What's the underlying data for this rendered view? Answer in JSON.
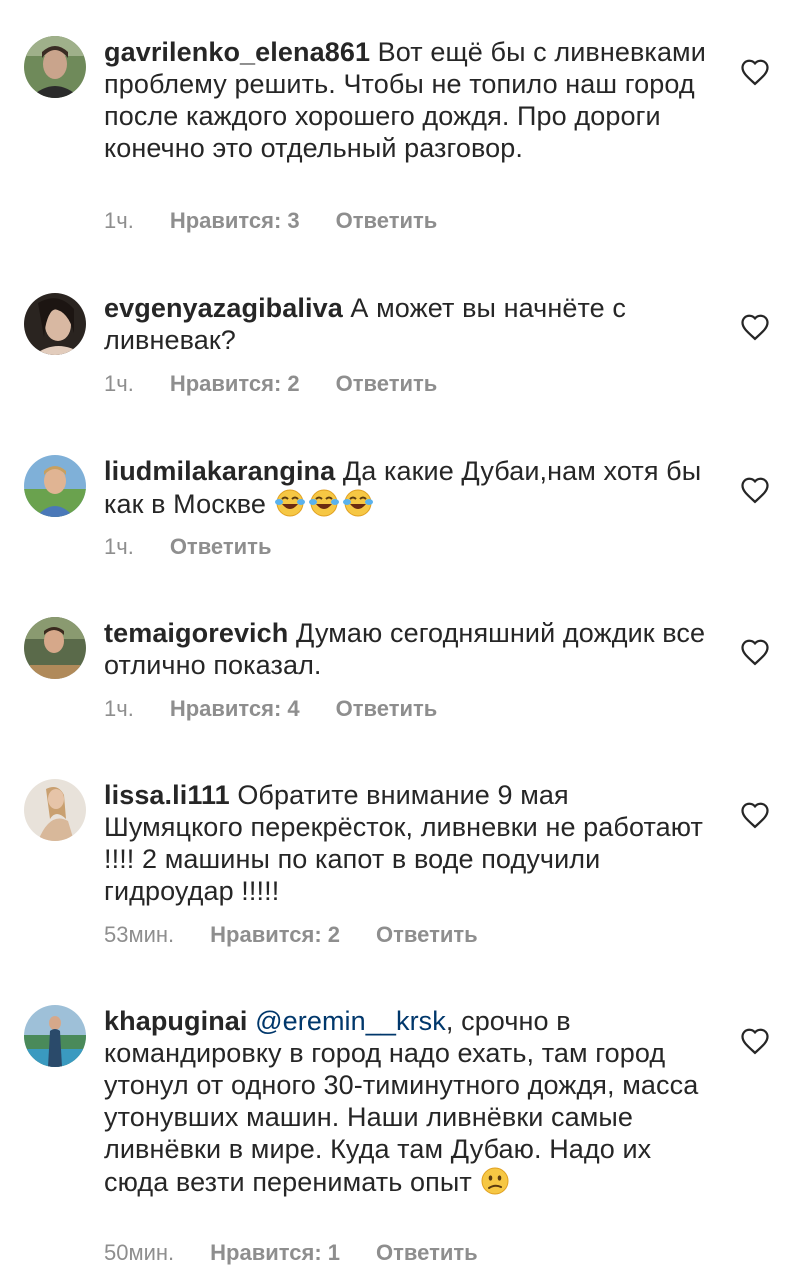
{
  "comments": [
    {
      "username": "gavrilenko_elena861",
      "text": " Вот ещё бы с ливневками проблему решить. Чтобы не топило наш город после каждого хорошего дождя. Про дороги конечно это отдельный разговор.",
      "time": "1ч.",
      "likes": "Нравится: 3",
      "reply": "Ответить"
    },
    {
      "username": "evgenyazagibaliva",
      "text": " А может вы начнёте с ливневак?",
      "time": "1ч.",
      "likes": "Нравится: 2",
      "reply": "Ответить"
    },
    {
      "username": "liudmilakarangina",
      "text": " Да какие Дубаи,нам хотя бы как в Москве",
      "time": "1ч.",
      "reply": "Ответить",
      "emojis": [
        "face-with-tears-of-joy",
        "face-with-tears-of-joy",
        "face-with-tears-of-joy"
      ]
    },
    {
      "username": "temaigorevich",
      "text": " Думаю сегодняшний дождик все отлично показал.",
      "time": "1ч.",
      "likes": "Нравится: 4",
      "reply": "Ответить"
    },
    {
      "username": "lissa.li111",
      "text": " Обратите внимание 9 мая Шумяцкого перекрёсток, ливневки не работают !!!! 2 машины по капот в воде подучили гидроудар !!!!!",
      "time": "53мин.",
      "likes": "Нравится: 2",
      "reply": "Ответить"
    },
    {
      "username": "khapuginai",
      "mention": "@eremin__krsk",
      "text": ", срочно в командировку в город надо ехать, там город утонул от одного 30-тиминутного дождя, масса утонувших машин. Наши ливнёвки самые ливнёвки в мире. Куда там Дубаю. Надо их сюда везти перенимать опыт ",
      "time": "50мин.",
      "likes": "Нравится: 1",
      "reply": "Ответить",
      "emojis": [
        "confused-face"
      ]
    }
  ],
  "icons": {
    "like": "heart-outline-icon"
  },
  "colors": {
    "text": "#262626",
    "meta": "#8e8e8e",
    "mention": "#00376b"
  }
}
